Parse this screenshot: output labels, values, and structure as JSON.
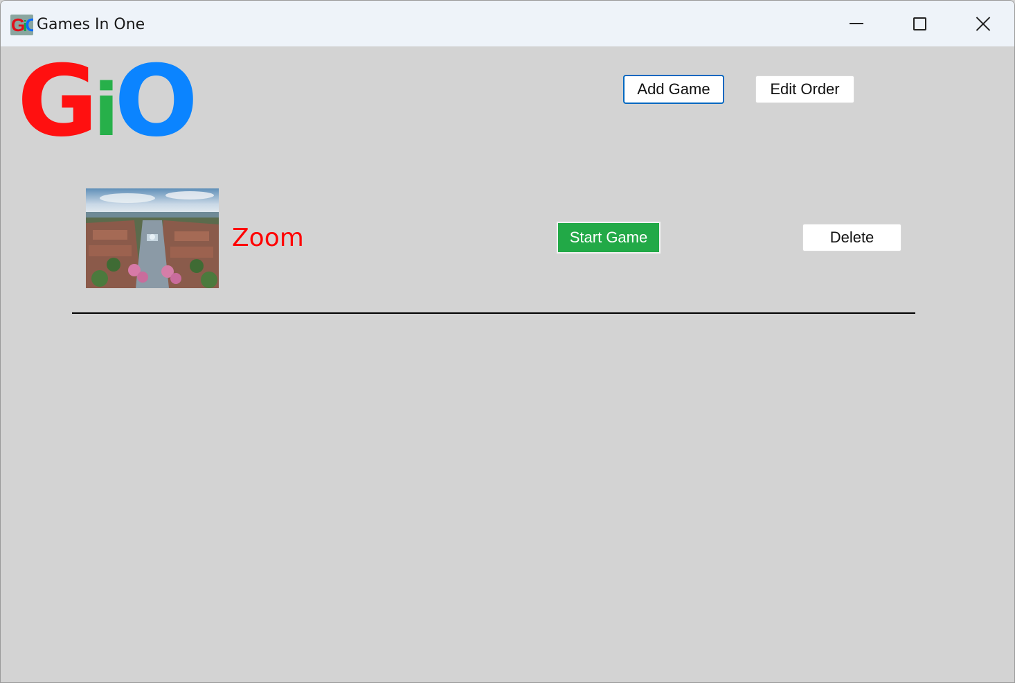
{
  "window": {
    "title": "Games In One",
    "icon_letters": {
      "g": "G",
      "i": "i",
      "o": "O"
    }
  },
  "logo": {
    "g": "G",
    "i": "i",
    "o": "O"
  },
  "toolbar": {
    "add_game_label": "Add Game",
    "edit_order_label": "Edit Order"
  },
  "games": [
    {
      "name": "Zoom",
      "start_label": "Start Game",
      "delete_label": "Delete"
    }
  ],
  "colors": {
    "background": "#d3d3d3",
    "logo_g": "#ff1010",
    "logo_i": "#27b04a",
    "logo_o": "#0b84ff",
    "start_button": "#22a947",
    "game_name": "#ff0000",
    "focus_border": "#0067c0"
  }
}
